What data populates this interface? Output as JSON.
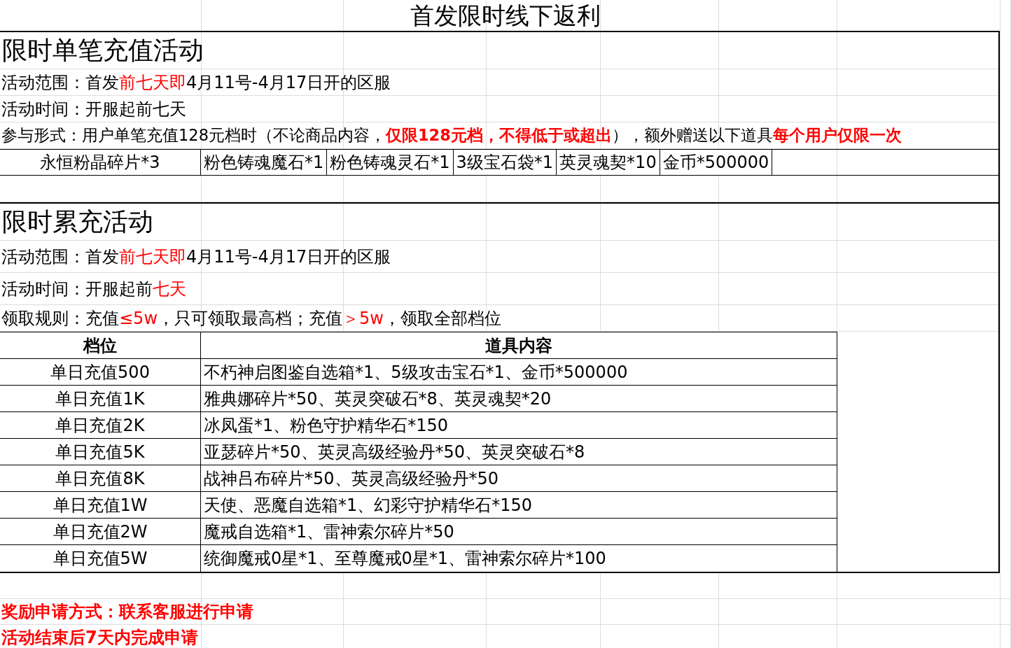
{
  "title": "首发限时线下返利",
  "single_topup": {
    "heading": "限时单笔充值活动",
    "lines": [
      [
        {
          "text": "活动范围：首发",
          "kind": "plain"
        },
        {
          "text": "前七天即",
          "kind": "highlight"
        },
        {
          "text": "4月11号-4月17日开的区服",
          "kind": "plain"
        }
      ],
      [
        {
          "text": "活动时间：开服起前七天",
          "kind": "plain"
        }
      ],
      [
        {
          "text": "参与形式：用户单笔充值128元档时（不论商品内容，",
          "kind": "plain"
        },
        {
          "text": "仅限128元档，不得低于或超出",
          "kind": "highlight-bold"
        },
        {
          "text": "），额外赠送以下道具",
          "kind": "plain"
        },
        {
          "text": "每个用户仅限一次",
          "kind": "highlight-bold"
        }
      ]
    ],
    "rewards": [
      "永恒粉晶碎片*3",
      "粉色铸魂魔石*1",
      "粉色铸魂灵石*1",
      "3级宝石袋*1",
      "英灵魂契*10",
      "金币*500000"
    ]
  },
  "cumulative_topup": {
    "heading": "限时累充活动",
    "lines": [
      [
        {
          "text": "活动范围：首发",
          "kind": "plain"
        },
        {
          "text": "前七天即",
          "kind": "highlight"
        },
        {
          "text": "4月11号-4月17日开的区服",
          "kind": "plain"
        }
      ],
      [
        {
          "text": "活动时间：开服起前",
          "kind": "plain"
        },
        {
          "text": "七天",
          "kind": "highlight"
        }
      ],
      [
        {
          "text": "领取规则：充值",
          "kind": "plain"
        },
        {
          "text": "≤5w",
          "kind": "highlight"
        },
        {
          "text": "，只可领取最高档；充值",
          "kind": "plain"
        },
        {
          "text": "＞5w",
          "kind": "highlight"
        },
        {
          "text": "，领取全部档位",
          "kind": "plain"
        }
      ]
    ],
    "table": {
      "columns": [
        "档位",
        "道具内容"
      ],
      "rows": [
        [
          "单日充值500",
          "不朽神启图鉴自选箱*1、5级攻击宝石*1、金币*500000"
        ],
        [
          "单日充值1K",
          "雅典娜碎片*50、英灵突破石*8、英灵魂契*20"
        ],
        [
          "单日充值2K",
          "冰凤蛋*1、粉色守护精华石*150"
        ],
        [
          "单日充值5K",
          "亚瑟碎片*50、英灵高级经验丹*50、英灵突破石*8"
        ],
        [
          "单日充值8K",
          "战神吕布碎片*50、英灵高级经验丹*50"
        ],
        [
          "单日充值1W",
          "天使、恶魔自选箱*1、幻彩守护精华石*150"
        ],
        [
          "单日充值2W",
          "魔戒自选箱*1、雷神索尔碎片*50"
        ],
        [
          "单日充值5W",
          "统御魔戒0星*1、至尊魔戒0星*1、雷神索尔碎片*100"
        ]
      ]
    }
  },
  "notes": [
    "奖励申请方式：联系客服进行申请",
    "活动结束后7天内完成申请"
  ]
}
